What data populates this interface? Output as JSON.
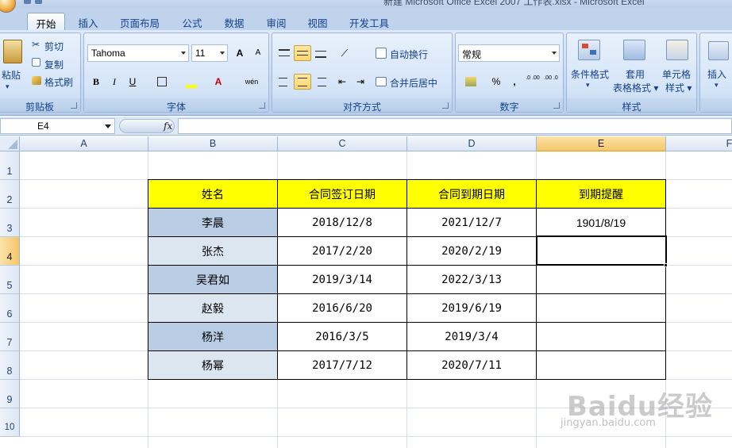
{
  "window": {
    "title": "新建 Microsoft Office Excel 2007 工作表.xlsx - Microsoft Excel"
  },
  "tabs": [
    "开始",
    "插入",
    "页面布局",
    "公式",
    "数据",
    "审阅",
    "视图",
    "开发工具"
  ],
  "ribbon": {
    "clipboard": {
      "label": "剪贴板",
      "paste": "粘贴",
      "cut": "剪切",
      "copy": "复制",
      "format_painter": "格式刷"
    },
    "font": {
      "label": "字体",
      "name": "Tahoma",
      "size": "11",
      "bold": "B",
      "italic": "I",
      "underline": "U",
      "grow": "A",
      "shrink": "A",
      "font_color_glyph": "A",
      "phonetic": "wén"
    },
    "alignment": {
      "label": "对齐方式",
      "wrap": "自动换行",
      "merge": "合并后居中"
    },
    "number": {
      "label": "数字",
      "format": "常规",
      "percent": "%",
      "comma": ",",
      "inc": ".0 .00",
      "dec": ".00 .0"
    },
    "styles": {
      "label": "样式",
      "conditional": "条件格式",
      "table": "套用\n表格格式",
      "cell_styles": "单元格\n样式"
    },
    "cells": {
      "insert": "插入"
    }
  },
  "formula_bar": {
    "name_box": "E4",
    "fx": "fx",
    "formula": ""
  },
  "columns": [
    "A",
    "B",
    "C",
    "D",
    "E",
    "F"
  ],
  "rows": [
    "1",
    "2",
    "3",
    "4",
    "5",
    "6",
    "7",
    "8",
    "9",
    "10"
  ],
  "table": {
    "headers": [
      "姓名",
      "合同签订日期",
      "合同到期日期",
      "到期提醒"
    ],
    "rows": [
      [
        "李晨",
        "2018/12/8",
        "2021/12/7",
        "1901/8/19"
      ],
      [
        "张杰",
        "2017/2/20",
        "2020/2/19",
        ""
      ],
      [
        "吴君如",
        "2019/3/14",
        "2022/3/13",
        ""
      ],
      [
        "赵毅",
        "2016/6/20",
        "2019/6/19",
        ""
      ],
      [
        "杨洋",
        "2016/3/5",
        "2019/3/4",
        ""
      ],
      [
        "杨幂",
        "2017/7/12",
        "2020/7/11",
        ""
      ]
    ]
  },
  "active_cell": "E4",
  "watermark": {
    "main": "Baidu经验",
    "sub": "jingyan.baidu.com"
  }
}
